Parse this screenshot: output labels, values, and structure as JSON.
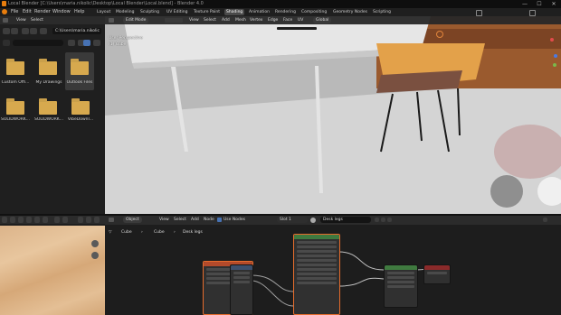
{
  "window": {
    "title": "Local Blender [C:\\Users\\maria.nikolic\\Desktop\\Local Blender\\Local.blend] - Blender 4.0",
    "controls": [
      "—",
      "☐",
      "✕"
    ]
  },
  "menubar": {
    "items": [
      "File",
      "Edit",
      "Render",
      "Window",
      "Help"
    ],
    "workspaces": [
      "Layout",
      "Modeling",
      "Sculpting",
      "UV Editing",
      "Texture Paint",
      "Shading",
      "Animation",
      "Rendering",
      "Compositing",
      "Geometry Nodes",
      "Scripting"
    ],
    "active_workspace": "Shading"
  },
  "file_browser": {
    "header": [
      "View",
      "Select"
    ],
    "path": "C:\\Users\\maria.nikolic",
    "folders": [
      {
        "label": "Custom Offi..."
      },
      {
        "label": "My Drawings"
      },
      {
        "label": "Outlook Files"
      },
      {
        "label": "SOLIDWORK..."
      },
      {
        "label": "SOLIDWORK..."
      },
      {
        "label": "VibeDownl..."
      }
    ]
  },
  "viewport": {
    "mode": "Edit Mode",
    "menu": [
      "View",
      "Select",
      "Add",
      "Mesh",
      "Vertex",
      "Edge",
      "Face",
      "UV"
    ],
    "orientation": "Global",
    "overlay_title": "User Perspective",
    "overlay_object": "(1) Cube"
  },
  "node_editor": {
    "object_mode": "Object",
    "menu": [
      "View",
      "Select",
      "Add",
      "Node"
    ],
    "use_nodes_label": "Use Nodes",
    "slot": "Slot 1",
    "material": "Desk legs",
    "breadcrumb": [
      "Cube",
      "Cube",
      "Desk legs"
    ]
  },
  "colors": {
    "accent": "#e66c2c",
    "active_tab": "#4a4a4a",
    "folder": "#d7a94e",
    "viewport_bg": "#c9c9c9"
  }
}
